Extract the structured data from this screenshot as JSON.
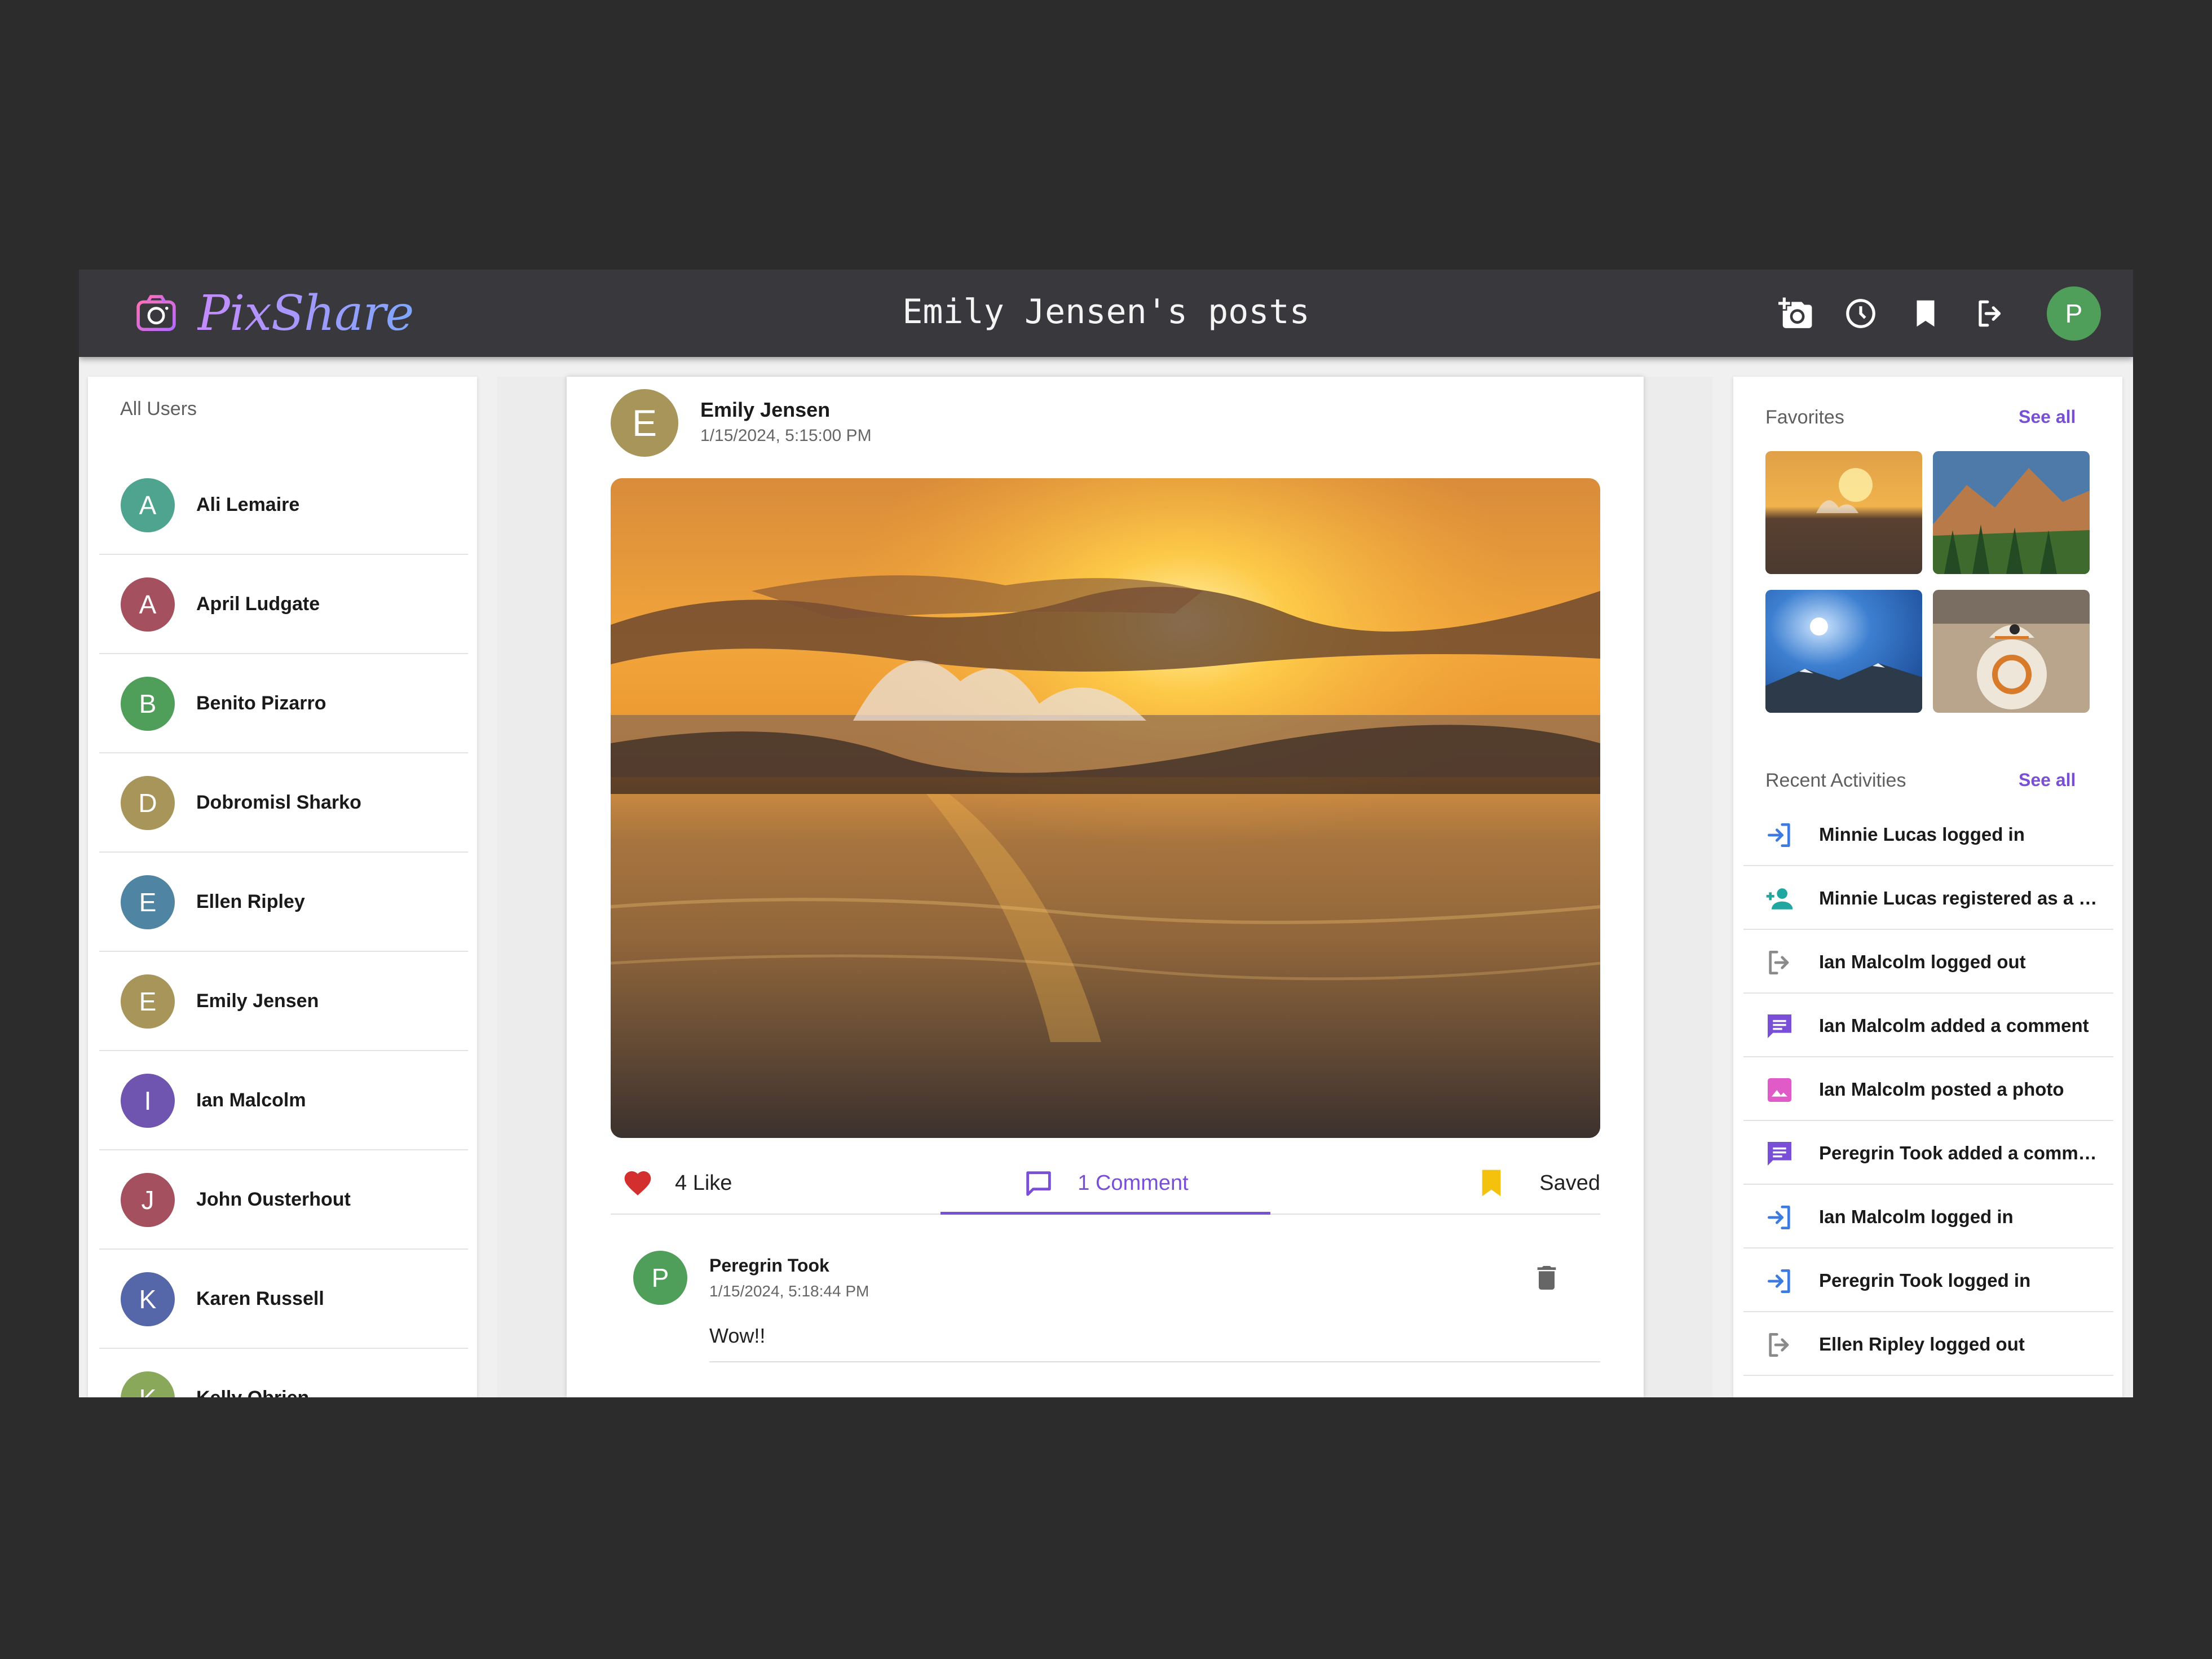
{
  "app": {
    "brand_name": "PixShare",
    "page_title": "Emily Jensen's posts",
    "current_user_initial": "P"
  },
  "header_icons": [
    "add-photo-icon",
    "history-icon",
    "bookmark-icon",
    "logout-icon"
  ],
  "users": {
    "heading": "All Users",
    "items": [
      {
        "initial": "A",
        "name": "Ali Lemaire",
        "color": "#4ea48e"
      },
      {
        "initial": "A",
        "name": "April Ludgate",
        "color": "#a5505f"
      },
      {
        "initial": "B",
        "name": "Benito Pizarro",
        "color": "#4f9f5a"
      },
      {
        "initial": "D",
        "name": "Dobromisl Sharko",
        "color": "#a7955a"
      },
      {
        "initial": "E",
        "name": "Ellen Ripley",
        "color": "#4f85a3"
      },
      {
        "initial": "E",
        "name": "Emily Jensen",
        "color": "#a7955a"
      },
      {
        "initial": "I",
        "name": "Ian Malcolm",
        "color": "#6f55b0"
      },
      {
        "initial": "J",
        "name": "John Ousterhout",
        "color": "#a5505f"
      },
      {
        "initial": "K",
        "name": "Karen Russell",
        "color": "#5567a8"
      },
      {
        "initial": "K",
        "name": "Kelly Obrien",
        "color": "#8aa85a"
      }
    ]
  },
  "post": {
    "author_initial": "E",
    "author": "Emily Jensen",
    "timestamp": "1/15/2024, 5:15:00 PM",
    "like_label": "4 Like",
    "comment_label": "1 Comment",
    "saved_label": "Saved"
  },
  "comments": [
    {
      "initial": "P",
      "author": "Peregrin Took",
      "timestamp": "1/15/2024, 5:18:44 PM",
      "text": "Wow!!"
    }
  ],
  "favorites": {
    "title": "Favorites",
    "see_all": "See all"
  },
  "activities": {
    "title": "Recent Activities",
    "see_all": "See all",
    "items": [
      {
        "icon": "login-icon",
        "text": "Minnie Lucas logged in"
      },
      {
        "icon": "person-add-icon",
        "text": "Minnie Lucas registered as a new user"
      },
      {
        "icon": "logout-icon",
        "text": "Ian Malcolm logged out"
      },
      {
        "icon": "comment-icon",
        "text": "Ian Malcolm added a comment"
      },
      {
        "icon": "image-icon",
        "text": "Ian Malcolm posted a photo"
      },
      {
        "icon": "comment-icon",
        "text": "Peregrin Took added a comment"
      },
      {
        "icon": "login-icon",
        "text": "Ian Malcolm logged in"
      },
      {
        "icon": "login-icon",
        "text": "Peregrin Took logged in"
      },
      {
        "icon": "logout-icon",
        "text": "Ellen Ripley logged out"
      }
    ]
  },
  "colors": {
    "accent": "#7a4fd8",
    "topbar": "#39383d",
    "like": "#d32f2f",
    "saved": "#f4c20d"
  }
}
